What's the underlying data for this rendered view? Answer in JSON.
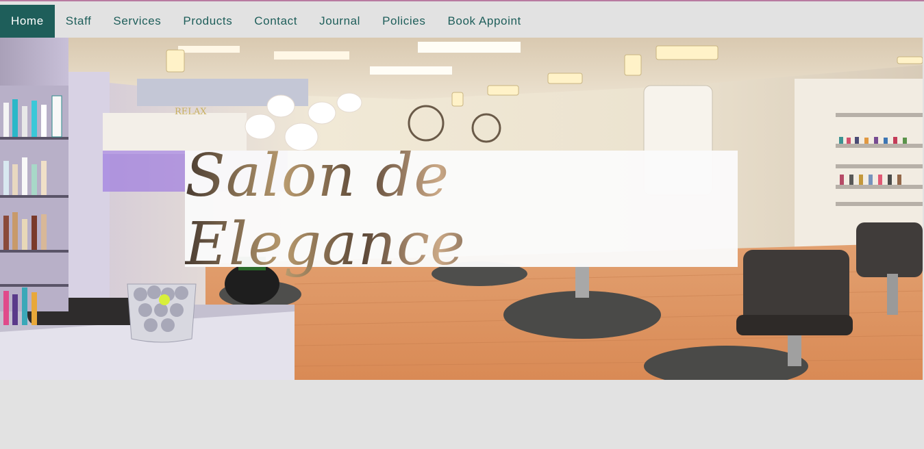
{
  "nav": {
    "items": [
      {
        "label": "Home",
        "active": true
      },
      {
        "label": "Staff",
        "active": false
      },
      {
        "label": "Services",
        "active": false
      },
      {
        "label": "Products",
        "active": false
      },
      {
        "label": "Contact",
        "active": false
      },
      {
        "label": "Journal",
        "active": false
      },
      {
        "label": "Policies",
        "active": false
      },
      {
        "label": "Book Appoint",
        "active": false
      }
    ]
  },
  "hero": {
    "title": "Salon de Elegance",
    "sign_text": "RELAX"
  },
  "colors": {
    "accent": "#1e5e5a",
    "page_background": "#e2e2e2",
    "top_border": "#b87aa0"
  }
}
